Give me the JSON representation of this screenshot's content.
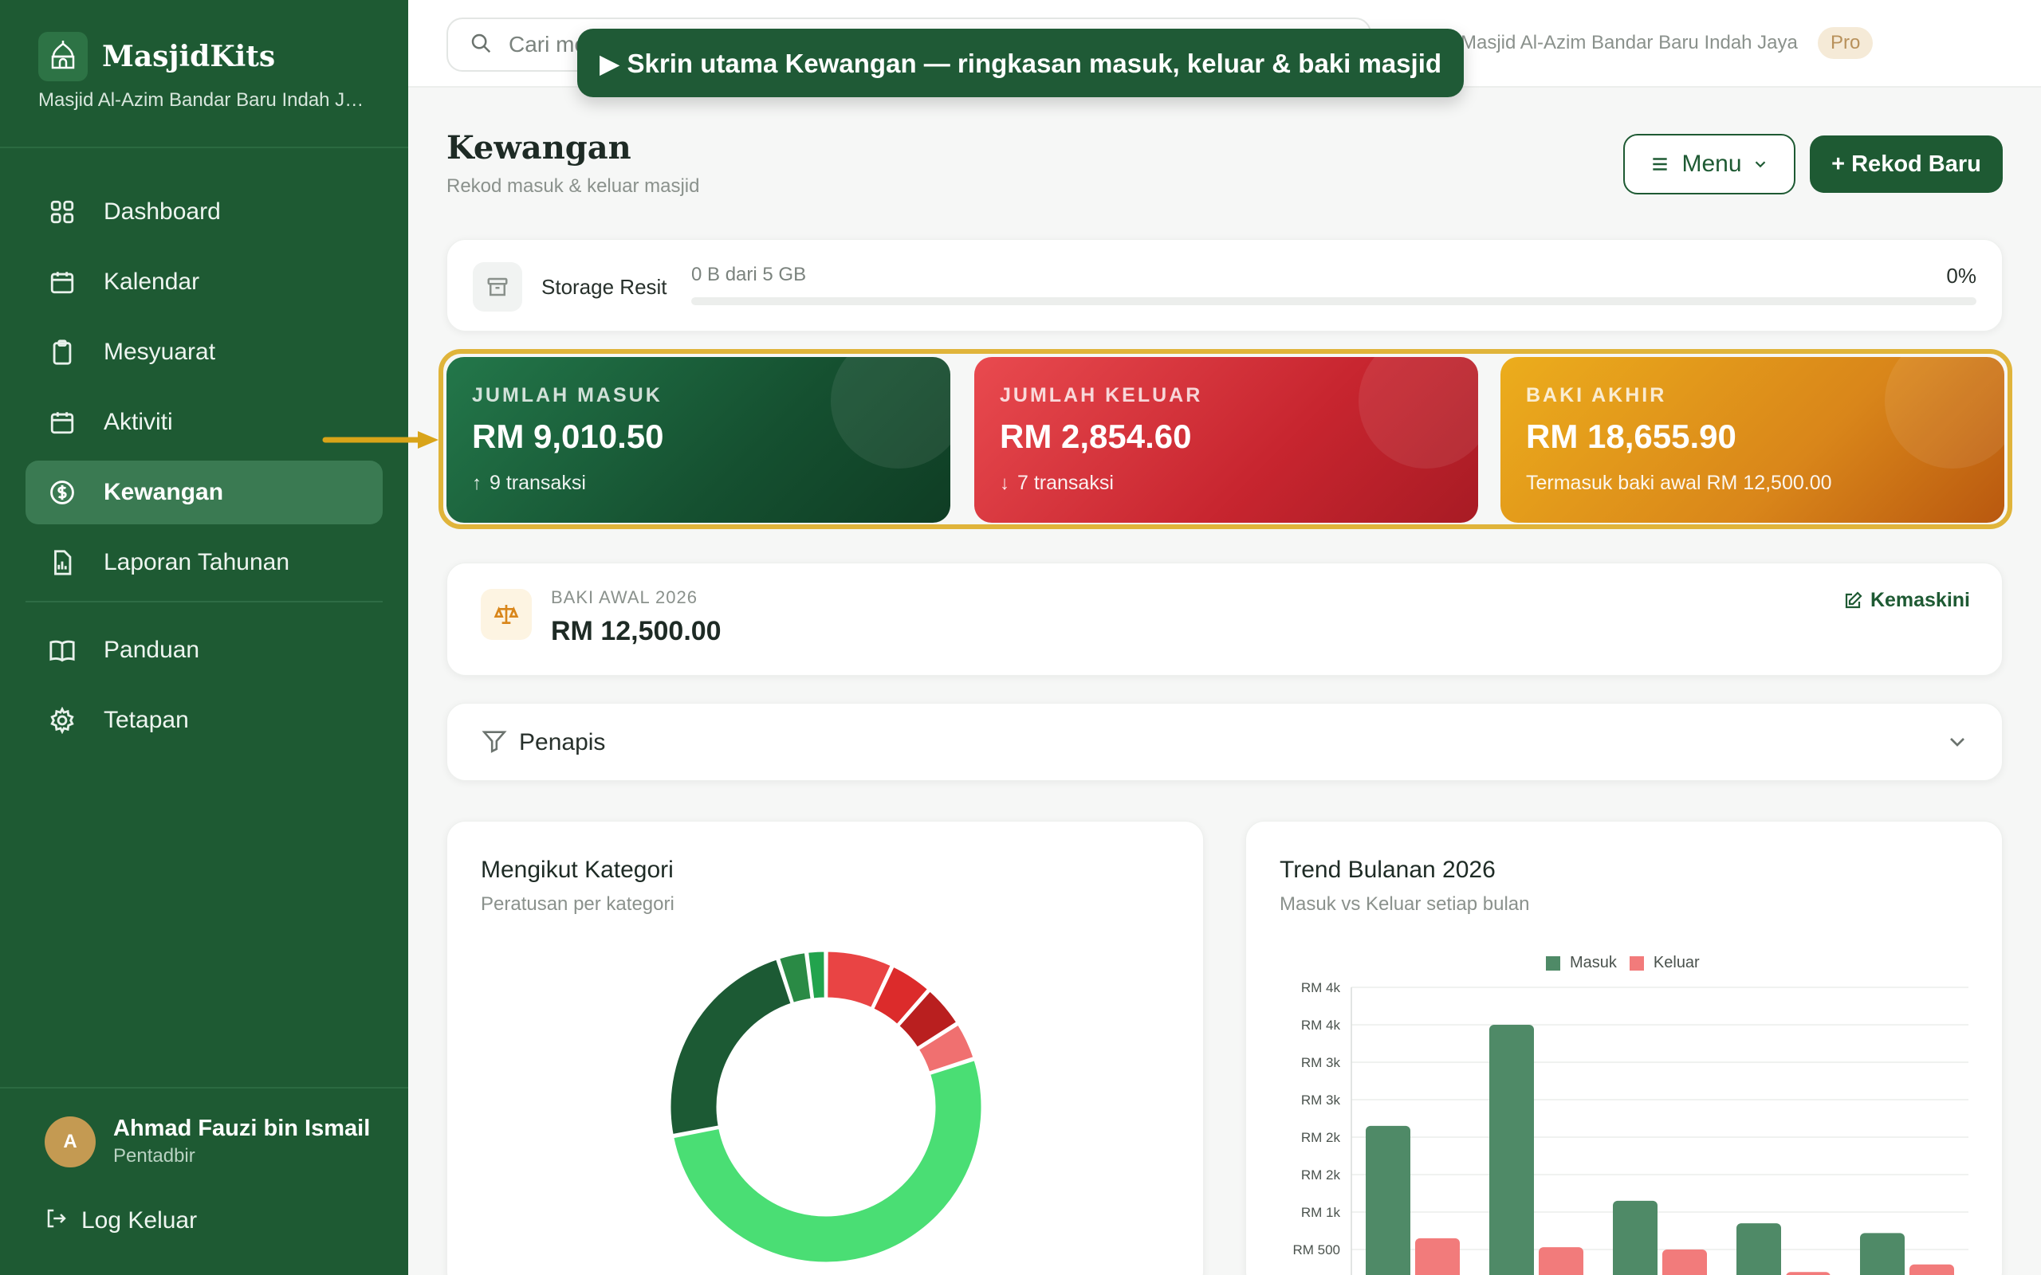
{
  "sidebar": {
    "brand": "MasjidKits",
    "mosque": "Masjid Al-Azim Bandar Baru Indah Jaya",
    "items": [
      {
        "label": "Dashboard",
        "icon": "grid-icon"
      },
      {
        "label": "Kalendar",
        "icon": "calendar-icon"
      },
      {
        "label": "Mesyuarat",
        "icon": "clipboard-icon"
      },
      {
        "label": "Aktiviti",
        "icon": "calendar-icon"
      },
      {
        "label": "Kewangan",
        "icon": "dollar-circle-icon",
        "active": true
      },
      {
        "label": "Laporan Tahunan",
        "icon": "report-icon"
      }
    ],
    "items2": [
      {
        "label": "Panduan",
        "icon": "book-icon"
      },
      {
        "label": "Tetapan",
        "icon": "gear-icon"
      }
    ],
    "user": {
      "initial": "A",
      "name": "Ahmad Fauzi bin Ismail",
      "role": "Pentadbir"
    },
    "logout": "Log Keluar"
  },
  "topbar": {
    "search_placeholder": "Cari me",
    "mosque": "Masjid Al-Azim Bandar Baru Indah Jaya",
    "plan": "Pro",
    "banner": "▶ Skrin utama Kewangan — ringkasan masuk, keluar & baki masjid"
  },
  "page": {
    "title": "Kewangan",
    "subtitle": "Rekod masuk & keluar masjid",
    "menu_label": "Menu",
    "new_label": "+ Rekod Baru"
  },
  "storage": {
    "label": "Storage Resit",
    "used": "0 B dari 5 GB",
    "percent_text": "0%",
    "percent": 0
  },
  "stats": {
    "in": {
      "label": "JUMLAH MASUK",
      "value": "RM 9,010.50",
      "sub": "9 transaksi"
    },
    "out": {
      "label": "JUMLAH KELUAR",
      "value": "RM 2,854.60",
      "sub": "7 transaksi"
    },
    "balance": {
      "label": "BAKI AKHIR",
      "value": "RM 18,655.90",
      "sub": "Termasuk baki awal RM 12,500.00"
    }
  },
  "opening": {
    "label": "BAKI AWAL 2026",
    "value": "RM 12,500.00",
    "edit": "Kemaskini"
  },
  "filter": {
    "label": "Penapis"
  },
  "colors": {
    "green": "#1e5a33",
    "red": "#c7252f",
    "amber": "#d9861a",
    "highlight": "#e0b43a"
  },
  "chart_data": [
    {
      "type": "pie",
      "title": "Mengikut Kategori",
      "subtitle": "Peratusan per kategori",
      "slices": [
        {
          "value": 7.0,
          "color": "#e94444"
        },
        {
          "value": 4.5,
          "color": "#dc2b2b"
        },
        {
          "value": 4.5,
          "color": "#b91f1f"
        },
        {
          "value": 4.0,
          "color": "#f07070"
        },
        {
          "value": 52.0,
          "color": "#4ade74"
        },
        {
          "value": 23.0,
          "color": "#1c5a34"
        },
        {
          "value": 3.0,
          "color": "#2a8a45"
        },
        {
          "value": 2.0,
          "color": "#22a34d"
        }
      ]
    },
    {
      "type": "bar",
      "title": "Trend Bulanan 2026",
      "subtitle": "Masuk vs Keluar setiap bulan",
      "ytick_labels": [
        "RM 4k",
        "RM 4k",
        "RM 3k",
        "RM 3k",
        "RM 2k",
        "RM 2k",
        "RM 1k",
        "RM 500"
      ],
      "ylim": [
        0,
        4000
      ],
      "series": [
        {
          "name": "Masuk",
          "color": "#4f8a67",
          "values": [
            2150,
            3500,
            1150,
            850,
            720
          ]
        },
        {
          "name": "Keluar",
          "color": "#f27b7b",
          "values": [
            650,
            530,
            500,
            200,
            300
          ]
        }
      ]
    }
  ]
}
